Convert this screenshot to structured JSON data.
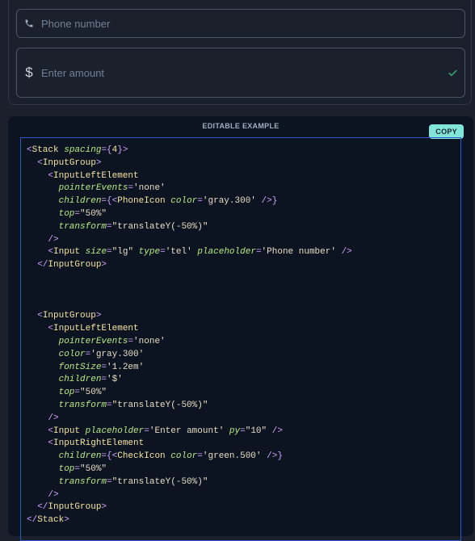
{
  "preview": {
    "phone": {
      "placeholder": "Phone number",
      "icon": "phone-icon"
    },
    "amount": {
      "placeholder": "Enter amount",
      "left_symbol": "$",
      "right_icon": "check-icon",
      "check_color": "#38a169"
    }
  },
  "editor": {
    "label": "EDITABLE EXAMPLE",
    "copy_label": "COPY",
    "lines": [
      [
        {
          "c": "punc",
          "t": "<"
        },
        {
          "c": "tag",
          "t": "Stack"
        },
        {
          "c": "txt",
          "t": " "
        },
        {
          "c": "attr",
          "t": "spacing"
        },
        {
          "c": "punc",
          "t": "={"
        },
        {
          "c": "tag",
          "t": "4"
        },
        {
          "c": "punc",
          "t": "}>"
        }
      ],
      [
        {
          "c": "txt",
          "t": "  "
        },
        {
          "c": "punc",
          "t": "<"
        },
        {
          "c": "tag",
          "t": "InputGroup"
        },
        {
          "c": "punc",
          "t": ">"
        }
      ],
      [
        {
          "c": "txt",
          "t": "    "
        },
        {
          "c": "punc",
          "t": "<"
        },
        {
          "c": "tag",
          "t": "InputLeftElement"
        }
      ],
      [
        {
          "c": "txt",
          "t": "      "
        },
        {
          "c": "attr",
          "t": "pointerEvents"
        },
        {
          "c": "punc",
          "t": "="
        },
        {
          "c": "str",
          "t": "'none'"
        }
      ],
      [
        {
          "c": "txt",
          "t": "      "
        },
        {
          "c": "attr",
          "t": "children"
        },
        {
          "c": "punc",
          "t": "={<"
        },
        {
          "c": "tag",
          "t": "PhoneIcon"
        },
        {
          "c": "txt",
          "t": " "
        },
        {
          "c": "attr",
          "t": "color"
        },
        {
          "c": "punc",
          "t": "="
        },
        {
          "c": "str",
          "t": "'gray.300'"
        },
        {
          "c": "txt",
          "t": " "
        },
        {
          "c": "punc",
          "t": "/>}"
        }
      ],
      [
        {
          "c": "txt",
          "t": "      "
        },
        {
          "c": "attr",
          "t": "top"
        },
        {
          "c": "punc",
          "t": "="
        },
        {
          "c": "str",
          "t": "\"50%\""
        }
      ],
      [
        {
          "c": "txt",
          "t": "      "
        },
        {
          "c": "attr",
          "t": "transform"
        },
        {
          "c": "punc",
          "t": "="
        },
        {
          "c": "str",
          "t": "\"translateY(-50%)\""
        }
      ],
      [
        {
          "c": "txt",
          "t": "    "
        },
        {
          "c": "punc",
          "t": "/>"
        }
      ],
      [
        {
          "c": "txt",
          "t": "    "
        },
        {
          "c": "punc",
          "t": "<"
        },
        {
          "c": "tag",
          "t": "Input"
        },
        {
          "c": "txt",
          "t": " "
        },
        {
          "c": "attr",
          "t": "size"
        },
        {
          "c": "punc",
          "t": "="
        },
        {
          "c": "str",
          "t": "\"lg\""
        },
        {
          "c": "txt",
          "t": " "
        },
        {
          "c": "attr",
          "t": "type"
        },
        {
          "c": "punc",
          "t": "="
        },
        {
          "c": "str",
          "t": "'tel'"
        },
        {
          "c": "txt",
          "t": " "
        },
        {
          "c": "attr",
          "t": "placeholder"
        },
        {
          "c": "punc",
          "t": "="
        },
        {
          "c": "str",
          "t": "'Phone number'"
        },
        {
          "c": "txt",
          "t": " "
        },
        {
          "c": "punc",
          "t": "/>"
        }
      ],
      [
        {
          "c": "txt",
          "t": "  "
        },
        {
          "c": "punc",
          "t": "</"
        },
        {
          "c": "tag",
          "t": "InputGroup"
        },
        {
          "c": "punc",
          "t": ">"
        }
      ],
      [],
      [],
      [],
      [
        {
          "c": "txt",
          "t": "  "
        },
        {
          "c": "punc",
          "t": "<"
        },
        {
          "c": "tag",
          "t": "InputGroup"
        },
        {
          "c": "punc",
          "t": ">"
        }
      ],
      [
        {
          "c": "txt",
          "t": "    "
        },
        {
          "c": "punc",
          "t": "<"
        },
        {
          "c": "tag",
          "t": "InputLeftElement"
        }
      ],
      [
        {
          "c": "txt",
          "t": "      "
        },
        {
          "c": "attr",
          "t": "pointerEvents"
        },
        {
          "c": "punc",
          "t": "="
        },
        {
          "c": "str",
          "t": "'none'"
        }
      ],
      [
        {
          "c": "txt",
          "t": "      "
        },
        {
          "c": "attr",
          "t": "color"
        },
        {
          "c": "punc",
          "t": "="
        },
        {
          "c": "str",
          "t": "'gray.300'"
        }
      ],
      [
        {
          "c": "txt",
          "t": "      "
        },
        {
          "c": "attr",
          "t": "fontSize"
        },
        {
          "c": "punc",
          "t": "="
        },
        {
          "c": "str",
          "t": "'1.2em'"
        }
      ],
      [
        {
          "c": "txt",
          "t": "      "
        },
        {
          "c": "attr",
          "t": "children"
        },
        {
          "c": "punc",
          "t": "="
        },
        {
          "c": "str",
          "t": "'$'"
        }
      ],
      [
        {
          "c": "txt",
          "t": "      "
        },
        {
          "c": "attr",
          "t": "top"
        },
        {
          "c": "punc",
          "t": "="
        },
        {
          "c": "str",
          "t": "\"50%\""
        }
      ],
      [
        {
          "c": "txt",
          "t": "      "
        },
        {
          "c": "attr",
          "t": "transform"
        },
        {
          "c": "punc",
          "t": "="
        },
        {
          "c": "str",
          "t": "\"translateY(-50%)\""
        }
      ],
      [
        {
          "c": "txt",
          "t": "    "
        },
        {
          "c": "punc",
          "t": "/>"
        }
      ],
      [
        {
          "c": "txt",
          "t": "    "
        },
        {
          "c": "punc",
          "t": "<"
        },
        {
          "c": "tag",
          "t": "Input"
        },
        {
          "c": "txt",
          "t": " "
        },
        {
          "c": "attr",
          "t": "placeholder"
        },
        {
          "c": "punc",
          "t": "="
        },
        {
          "c": "str",
          "t": "'Enter amount'"
        },
        {
          "c": "txt",
          "t": " "
        },
        {
          "c": "attr",
          "t": "py"
        },
        {
          "c": "punc",
          "t": "="
        },
        {
          "c": "str",
          "t": "\"10\""
        },
        {
          "c": "txt",
          "t": " "
        },
        {
          "c": "punc",
          "t": "/>"
        }
      ],
      [
        {
          "c": "txt",
          "t": "    "
        },
        {
          "c": "punc",
          "t": "<"
        },
        {
          "c": "tag",
          "t": "InputRightElement"
        }
      ],
      [
        {
          "c": "txt",
          "t": "      "
        },
        {
          "c": "attr",
          "t": "children"
        },
        {
          "c": "punc",
          "t": "={<"
        },
        {
          "c": "tag",
          "t": "CheckIcon"
        },
        {
          "c": "txt",
          "t": " "
        },
        {
          "c": "attr",
          "t": "color"
        },
        {
          "c": "punc",
          "t": "="
        },
        {
          "c": "str",
          "t": "'green.500'"
        },
        {
          "c": "txt",
          "t": " "
        },
        {
          "c": "punc",
          "t": "/>}"
        }
      ],
      [
        {
          "c": "txt",
          "t": "      "
        },
        {
          "c": "attr",
          "t": "top"
        },
        {
          "c": "punc",
          "t": "="
        },
        {
          "c": "str",
          "t": "\"50%\""
        }
      ],
      [
        {
          "c": "txt",
          "t": "      "
        },
        {
          "c": "attr",
          "t": "transform"
        },
        {
          "c": "punc",
          "t": "="
        },
        {
          "c": "str",
          "t": "\"translateY(-50%)\""
        }
      ],
      [
        {
          "c": "txt",
          "t": "    "
        },
        {
          "c": "punc",
          "t": "/>"
        }
      ],
      [
        {
          "c": "txt",
          "t": "  "
        },
        {
          "c": "punc",
          "t": "</"
        },
        {
          "c": "tag",
          "t": "InputGroup"
        },
        {
          "c": "punc",
          "t": ">"
        }
      ],
      [
        {
          "c": "punc",
          "t": "</"
        },
        {
          "c": "tag",
          "t": "Stack"
        },
        {
          "c": "punc",
          "t": ">"
        }
      ]
    ]
  }
}
